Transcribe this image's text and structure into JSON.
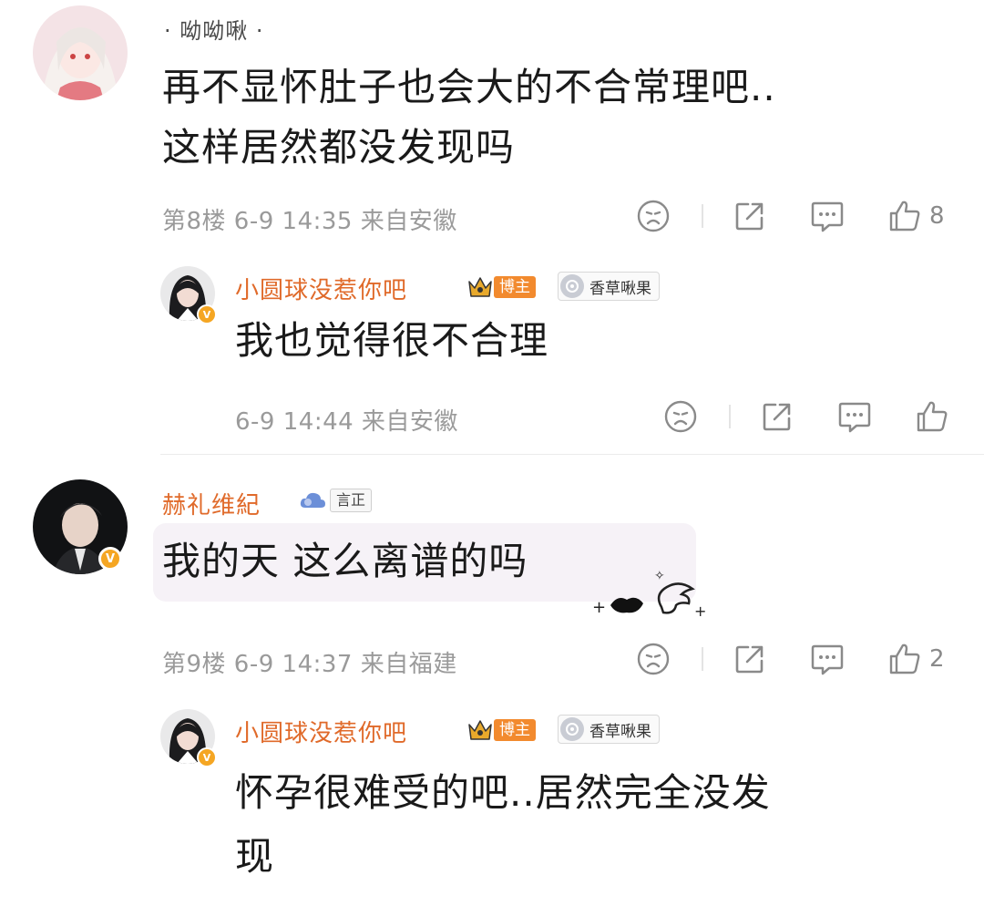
{
  "comments": [
    {
      "username": "· 呦呦啾 ·",
      "text_lines": [
        "再不显怀肚子也会大的不合常理吧..",
        "这样居然都没发现吗"
      ],
      "meta": "第8楼 6-9 14:35 来自安徽",
      "like_count": "8",
      "reply": {
        "username": "小圆球没惹你吧",
        "blogger_tag": "博主",
        "fan_tag": "香草啾果",
        "text_lines": [
          "我也觉得很不合理"
        ],
        "meta": "6-9 14:44 来自安徽",
        "like_count": ""
      }
    },
    {
      "username": "赫礼维紀",
      "badge": "言正",
      "text_lines": [
        "我的天 这么离谱的吗"
      ],
      "meta": "第9楼 6-9 14:37 来自福建",
      "like_count": "2",
      "reply": {
        "username": "小圆球没惹你吧",
        "blogger_tag": "博主",
        "fan_tag": "香草啾果",
        "text_lines": [
          "怀孕很难受的吧..居然完全没发",
          "现"
        ]
      }
    }
  ],
  "colors": {
    "name_orange": "#e06a2a",
    "meta_grey": "#9a9a9a",
    "blogger_orange": "#f28a2e",
    "verify_yellow": "#f5a623"
  },
  "icons": [
    "sad-face-icon",
    "share-icon",
    "comment-icon",
    "thumbs-up-icon",
    "crown-icon",
    "fan-badge-icon",
    "cloud-icon"
  ]
}
